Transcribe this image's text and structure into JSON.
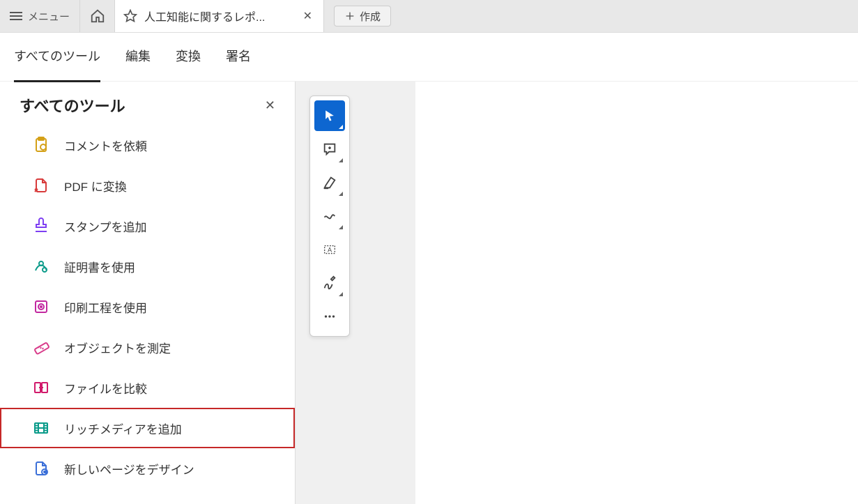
{
  "topbar": {
    "menu_label": "メニュー",
    "tab_title": "人工知能に関するレポ...",
    "create_label": "作成"
  },
  "nav": {
    "tabs": [
      "すべてのツール",
      "編集",
      "変換",
      "署名"
    ],
    "active_index": 0
  },
  "sidebar": {
    "title": "すべてのツール",
    "items": [
      {
        "label": "コメントを依頼",
        "icon": "request-comment-icon",
        "color": "#d4a017"
      },
      {
        "label": "PDF に変換",
        "icon": "convert-pdf-icon",
        "color": "#d83b3b"
      },
      {
        "label": "スタンプを追加",
        "icon": "stamp-icon",
        "color": "#7e3ff2"
      },
      {
        "label": "証明書を使用",
        "icon": "certificate-icon",
        "color": "#0b9b8a"
      },
      {
        "label": "印刷工程を使用",
        "icon": "print-production-icon",
        "color": "#c228a0"
      },
      {
        "label": "オブジェクトを測定",
        "icon": "measure-icon",
        "color": "#d83b8a"
      },
      {
        "label": "ファイルを比較",
        "icon": "compare-icon",
        "color": "#d11a6b"
      },
      {
        "label": "リッチメディアを追加",
        "icon": "rich-media-icon",
        "color": "#0b9b8a",
        "highlighted": true
      },
      {
        "label": "新しいページをデザイン",
        "icon": "design-page-icon",
        "color": "#3b6fd8"
      }
    ]
  },
  "float_toolbar": {
    "items": [
      {
        "name": "select-tool-icon",
        "active": true
      },
      {
        "name": "add-comment-icon"
      },
      {
        "name": "highlight-icon"
      },
      {
        "name": "draw-freeform-icon"
      },
      {
        "name": "text-box-icon"
      },
      {
        "name": "sign-icon"
      },
      {
        "name": "more-icon"
      }
    ]
  }
}
